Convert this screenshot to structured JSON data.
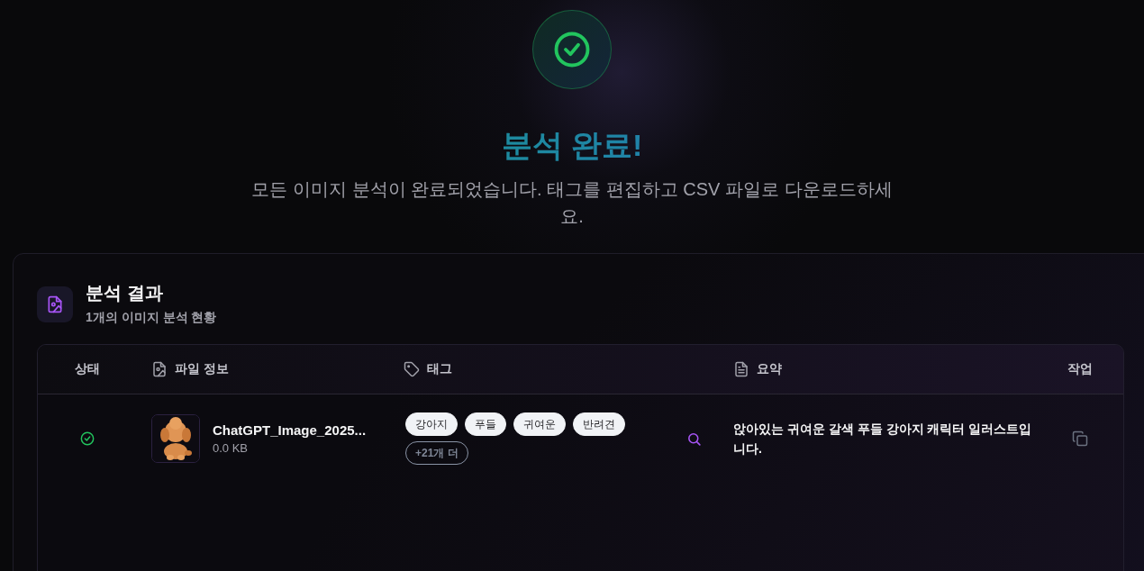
{
  "hero": {
    "complete": true,
    "title": "분석 완료!",
    "subtitle": "모든 이미지 분석이 완료되었습니다. 태그를 편집하고 CSV 파일로 다운로드하세요."
  },
  "results": {
    "title": "분석 결과",
    "subtitle": "1개의 이미지 분석 현황",
    "columns": [
      {
        "label": "상태",
        "kind": "status"
      },
      {
        "label": "파일 정보",
        "kind": "file"
      },
      {
        "label": "태그",
        "kind": "tags"
      },
      {
        "label": "요약",
        "kind": "summary"
      },
      {
        "label": "작업",
        "kind": "actions"
      }
    ],
    "rows": [
      {
        "complete": true,
        "thumbnail": {
          "kind": "picture"
        },
        "file_name": "ChatGPT_Image_2025...",
        "file_size": "0.0 KB",
        "tags": [
          "강아지",
          "푸들",
          "귀여운",
          "반려견"
        ],
        "more_tags": "+21개 더",
        "summary": "앉아있는 귀여운 갈색 푸들 강아지 캐릭터 일러스트입니다."
      }
    ]
  }
}
